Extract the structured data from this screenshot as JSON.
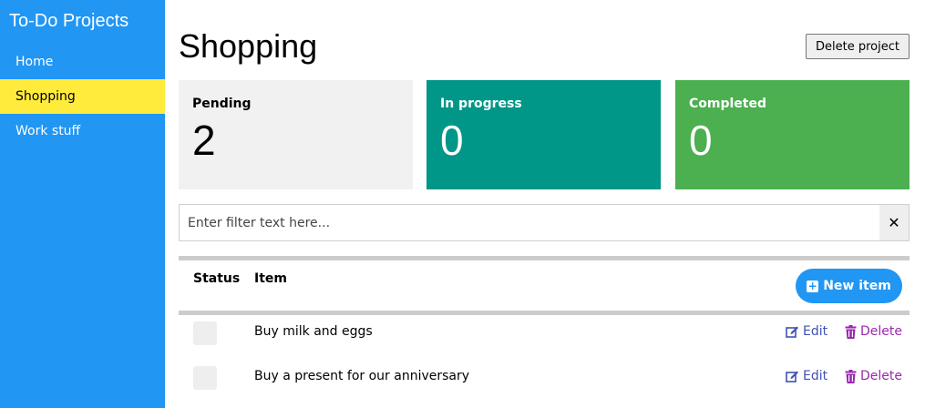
{
  "sidebar": {
    "title": "To-Do Projects",
    "items": [
      {
        "label": "Home"
      },
      {
        "label": "Shopping"
      },
      {
        "label": "Work stuff"
      }
    ]
  },
  "header": {
    "title": "Shopping",
    "delete_project_label": "Delete project"
  },
  "cards": [
    {
      "label": "Pending",
      "count": "2",
      "color": "#f1f1f1"
    },
    {
      "label": "In progress",
      "count": "0",
      "color": "#009688"
    },
    {
      "label": "Completed",
      "count": "0",
      "color": "#4caf50"
    }
  ],
  "filter": {
    "placeholder": "Enter filter text here...",
    "value": "",
    "clear_symbol": "✕"
  },
  "table": {
    "headers": {
      "status": "Status",
      "item": "Item"
    },
    "new_item_label": "New item",
    "rows": [
      {
        "text": "Buy milk and eggs",
        "edit_label": "Edit",
        "delete_label": "Delete"
      },
      {
        "text": "Buy a present for our anniversary",
        "edit_label": "Edit",
        "delete_label": "Delete"
      }
    ]
  },
  "colors": {
    "sidebar": "#2196f3",
    "active_nav": "#ffeb3b",
    "edit": "#3f51b5",
    "delete": "#9c27b0"
  }
}
